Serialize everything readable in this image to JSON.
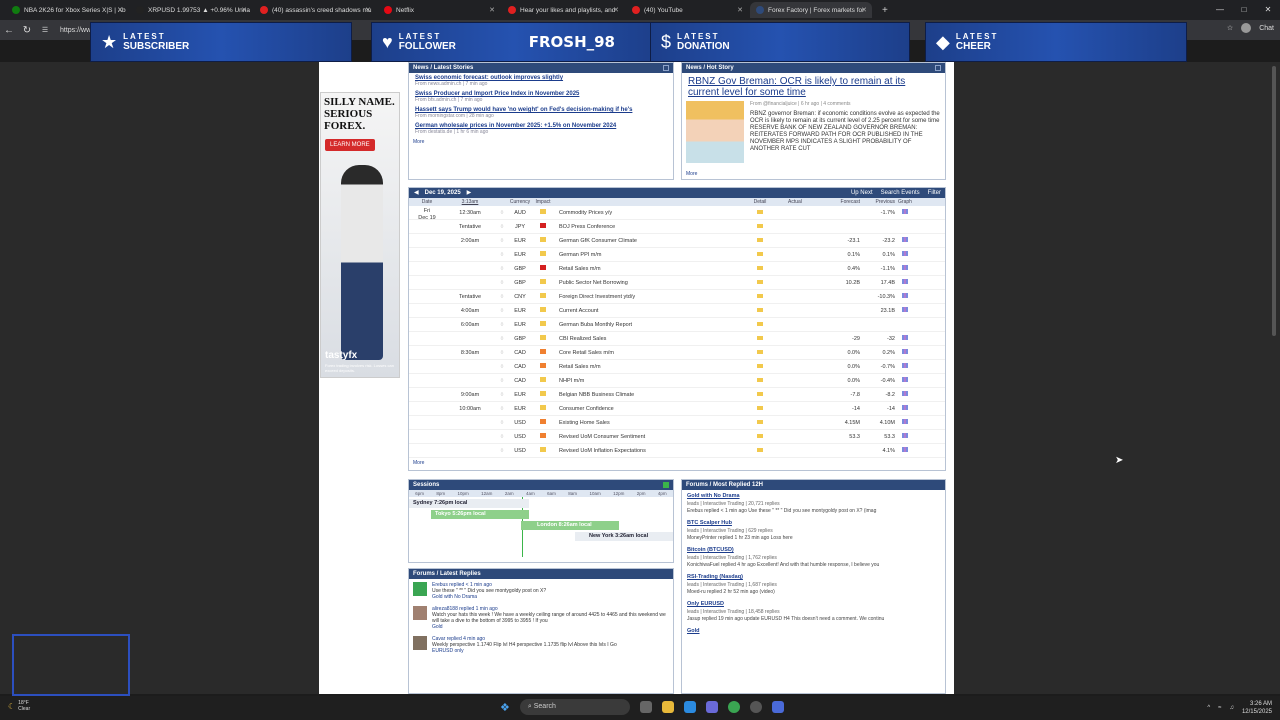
{
  "browser": {
    "tabs": [
      {
        "label": "NBA 2K26 for Xbox Series X|S | Xb",
        "color": "#107c10"
      },
      {
        "label": "XRPUSD 1.99753 ▲ +0.96% Unna",
        "color": "#222"
      },
      {
        "label": "(40) assassin's creed shadows mu",
        "color": "#e02020"
      },
      {
        "label": "Netflix",
        "color": "#e50914"
      },
      {
        "label": "Hear your likes and playlists, and",
        "color": "#e02020"
      },
      {
        "label": "(40) YouTube",
        "color": "#e02020"
      },
      {
        "label": "Forex Factory | Forex markets for",
        "color": "#2e4a7a"
      }
    ],
    "url": "https://www",
    "chat_label": "Chat"
  },
  "overlays": [
    {
      "l1": "LATEST",
      "l2": "SUBSCRIBER",
      "value": "",
      "icon": "star-icon"
    },
    {
      "l1": "LATEST",
      "l2": "FOLLOWER",
      "value": "FROSH_98",
      "icon": "heart-icon"
    },
    {
      "l1": "LATEST",
      "l2": "DONATION",
      "value": "",
      "icon": "dollar-icon"
    },
    {
      "l1": "LATEST",
      "l2": "CHEER",
      "value": "",
      "icon": "diamond-icon"
    }
  ],
  "ad": {
    "headline": "SILLY NAME. SERIOUS FOREX.",
    "button": "LEARN MORE",
    "brand": "tastyfx",
    "small": "Forex trading involves risk. Losses can exceed deposits."
  },
  "latest_stories": {
    "header": "News / Latest Stories",
    "items": [
      {
        "title": "Swiss economic forecast: outlook improves slightly",
        "source": "From news.admin.ch | 7 min ago"
      },
      {
        "title": "Swiss Producer and Import Price Index in November 2025",
        "source": "From bfs.admin.ch | 7 min ago"
      },
      {
        "title": "Hassett says Trump would have 'no weight' on Fed's decision-making if he's",
        "source": "From morningstar.com | 28 min ago"
      },
      {
        "title": "German wholesale prices in November 2025: +1.5% on November 2024",
        "source": "From destatis.de | 1 hr 6 min ago"
      }
    ],
    "more": "More"
  },
  "hot_story": {
    "header": "News / Hot Story",
    "title": "RBNZ Gov Breman: OCR is likely to remain at its current level for some time",
    "meta": "From @financialjuice | 6 hr ago | 4 comments",
    "body": "RBNZ governor Breman: if economic conditions evolve as expected the OCR is likely to remain at its current level of 2.25 percent for some time RESERVE BANK OF NEW ZEALAND GOVERNOR BREMAN: REITERATES FORWARD PATH FOR OCR PUBLISHED IN THE NOVEMBER MPS INDICATES A SLIGHT PROBABILITY OF ANOTHER RATE CUT",
    "more": "More"
  },
  "calendar": {
    "date": "Dec 19, 2025",
    "up_next": "Up Next",
    "search": "Search Events",
    "filter": "Filter",
    "columns": [
      "Date",
      "3:13am",
      "Currency",
      "Impact",
      "",
      "Detail",
      "Actual",
      "Forecast",
      "Previous",
      "Graph"
    ],
    "day_label": "Fri",
    "day_date": "Dec 19",
    "rows": [
      {
        "time": "12:30am",
        "cur": "AUD",
        "imp": "#f2c94c",
        "event": "Commodity Prices y/y",
        "fc": "",
        "pr": "-1.7%"
      },
      {
        "time": "Tentative",
        "cur": "JPY",
        "imp": "#d42020",
        "event": "BOJ Press Conference",
        "fc": "",
        "pr": ""
      },
      {
        "time": "2:00am",
        "cur": "EUR",
        "imp": "#f2c94c",
        "event": "German GfK Consumer Climate",
        "fc": "-23.1",
        "pr": "-23.2"
      },
      {
        "time": "",
        "cur": "EUR",
        "imp": "#f2c94c",
        "event": "German PPI m/m",
        "fc": "0.1%",
        "pr": "0.1%"
      },
      {
        "time": "",
        "cur": "GBP",
        "imp": "#d42020",
        "event": "Retail Sales m/m",
        "fc": "0.4%",
        "pr": "-1.1%"
      },
      {
        "time": "",
        "cur": "GBP",
        "imp": "#f2c94c",
        "event": "Public Sector Net Borrowing",
        "fc": "10.2B",
        "pr": "17.4B"
      },
      {
        "time": "Tentative",
        "cur": "CNY",
        "imp": "#f2c94c",
        "event": "Foreign Direct Investment ytd/y",
        "fc": "",
        "pr": "-10.3%"
      },
      {
        "time": "4:00am",
        "cur": "EUR",
        "imp": "#f2c94c",
        "event": "Current Account",
        "fc": "",
        "pr": "23.1B"
      },
      {
        "time": "6:00am",
        "cur": "EUR",
        "imp": "#f2c94c",
        "event": "German Buba Monthly Report",
        "fc": "",
        "pr": ""
      },
      {
        "time": "",
        "cur": "GBP",
        "imp": "#f2c94c",
        "event": "CBI Realized Sales",
        "fc": "-29",
        "pr": "-32"
      },
      {
        "time": "8:30am",
        "cur": "CAD",
        "imp": "#f08030",
        "event": "Core Retail Sales m/m",
        "fc": "0.0%",
        "pr": "0.2%"
      },
      {
        "time": "",
        "cur": "CAD",
        "imp": "#f08030",
        "event": "Retail Sales m/m",
        "fc": "0.0%",
        "pr": "-0.7%"
      },
      {
        "time": "",
        "cur": "CAD",
        "imp": "#f2c94c",
        "event": "NHPI m/m",
        "fc": "0.0%",
        "pr": "-0.4%"
      },
      {
        "time": "9:00am",
        "cur": "EUR",
        "imp": "#f2c94c",
        "event": "Belgian NBB Business Climate",
        "fc": "-7.8",
        "pr": "-8.2"
      },
      {
        "time": "10:00am",
        "cur": "EUR",
        "imp": "#f2c94c",
        "event": "Consumer Confidence",
        "fc": "-14",
        "pr": "-14"
      },
      {
        "time": "",
        "cur": "USD",
        "imp": "#f08030",
        "event": "Existing Home Sales",
        "fc": "4.15M",
        "pr": "4.10M"
      },
      {
        "time": "",
        "cur": "USD",
        "imp": "#f08030",
        "event": "Revised UoM Consumer Sentiment",
        "fc": "53.3",
        "pr": "53.3"
      },
      {
        "time": "",
        "cur": "USD",
        "imp": "#f2c94c",
        "event": "Revised UoM Inflation Expectations",
        "fc": "",
        "pr": "4.1%"
      }
    ],
    "more": "More"
  },
  "sessions": {
    "header": "Sessions",
    "hours": [
      "6pm",
      "8pm",
      "10pm",
      "12am",
      "2am",
      "4am",
      "6am",
      "8am",
      "10am",
      "12pm",
      "2pm",
      "4pm"
    ],
    "sydney": "Sydney  7:26pm local",
    "tokyo": "Tokyo  5:26pm local",
    "london": "London  8:26am local",
    "newyork": "New York  3:26am local"
  },
  "latest_replies": {
    "header": "Forums / Latest Replies",
    "items": [
      {
        "who": "Erebus replied < 1 min ago",
        "text": "Use these \" ** \" Did you see montygoldy post on X?",
        "thread": "Gold with No Drama"
      },
      {
        "who": "alireza8188 replied 1 min ago",
        "text": "Watch your hats this week ! We have a weekly ceiling range of around 4425 to 4465 and this weekend we will take a dive to the bottom of 3995 to 3955 ! If you",
        "thread": "Gold"
      },
      {
        "who": "Cavar replied 4 min ago",
        "text": "Weekly perspective 1.1740 Flip lvl H4 perspective 1.1735 flip lvl Above this lvls I Go",
        "thread": "EURUSD only"
      }
    ]
  },
  "most_replied": {
    "header": "Forums / Most Replied 12H",
    "items": [
      {
        "title": "Gold with No Drama",
        "stats": "leads | Interactive Trading | 20,721 replies",
        "last": "Erebus replied < 1 min ago  Use these \" ** \" Did you see montygoldy post on X? (imag"
      },
      {
        "title": "BTC Scalper Hub",
        "stats": "leads | Interactive Trading | 629 replies",
        "last": "MoneyPrinter replied 1 hr 23 min ago  Loss here"
      },
      {
        "title": "Bitcoin (BTCUSD)",
        "stats": "leads | Interactive Trading | 1,762 replies",
        "last": "KonichiwaFuel replied 4 hr ago  Excellent! And with that humble response, I believe you"
      },
      {
        "title": "RSI-Trading (Nasdaq)",
        "stats": "leads | Interactive Trading | 1,687 replies",
        "last": "Moed-ru replied 2 hr 52 min ago  (video)"
      },
      {
        "title": "Only EURUSD",
        "stats": "leads | Interactive Trading | 18,458 replies",
        "last": "Jasup replied 19 min ago  update EURUSD H4 This doesn't need a comment. We continu"
      },
      {
        "title": "Gold",
        "stats": "",
        "last": ""
      }
    ]
  },
  "taskbar": {
    "weather_temp": "18°F",
    "weather_desc": "Clear",
    "search": "Search",
    "time": "3:26 AM",
    "date": "12/15/2025"
  }
}
